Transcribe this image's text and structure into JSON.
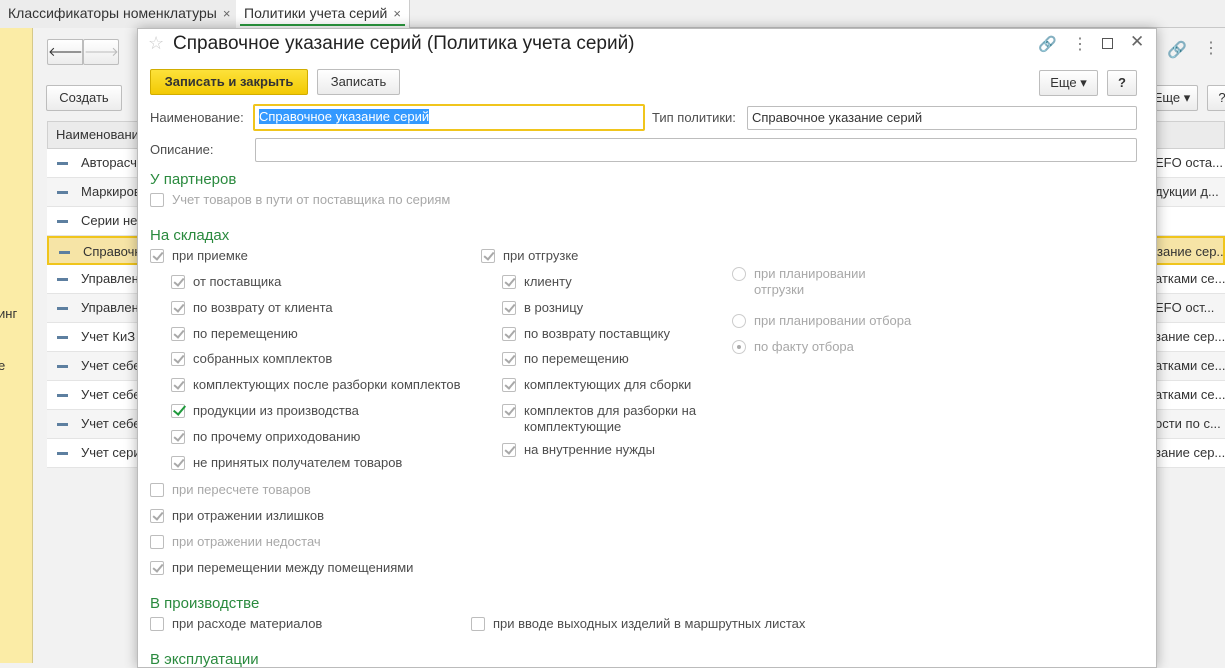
{
  "tabs": [
    {
      "label": "Классификаторы номенклатуры",
      "close": "×"
    },
    {
      "label": "Политики учета серий",
      "close": "×"
    }
  ],
  "sidebar": {
    "frag1": "инг",
    "frag2": "е"
  },
  "background": {
    "create": "Создать",
    "more": "Еще",
    "help": "?",
    "column": "Наименование",
    "rows": [
      {
        "name": "Авторасчет",
        "right": "EFO оста..."
      },
      {
        "name": "Маркировка",
        "right": "дукции д..."
      },
      {
        "name": "Серии не",
        "right": ""
      },
      {
        "name": "Справочное",
        "right": "зание сер..."
      },
      {
        "name": "Управление",
        "right": "атками се..."
      },
      {
        "name": "Управление",
        "right": "EFO ост..."
      },
      {
        "name": "Учет КиЗ",
        "right": "зание сер..."
      },
      {
        "name": "Учет себе",
        "right": "атками се..."
      },
      {
        "name": "Учет себе",
        "right": "атками се..."
      },
      {
        "name": "Учет себе",
        "right": "ости по с..."
      },
      {
        "name": "Учет серий",
        "right": "зание сер..."
      }
    ]
  },
  "modal": {
    "title": "Справочное указание серий (Политика учета серий)",
    "save_close": "Записать и закрыть",
    "save": "Записать",
    "more": "Еще",
    "help": "?",
    "name_label": "Наименование:",
    "name_value": "Справочное указание серий",
    "type_label": "Тип политики:",
    "type_value": "Справочное указание серий",
    "desc_label": "Описание:",
    "desc_value": "",
    "partners": {
      "title": "У партнеров",
      "transit": "Учет товаров в пути от поставщика по сериям"
    },
    "warehouses": {
      "title": "На складах",
      "receipt": "при приемке",
      "receipt_items": [
        "от поставщика",
        "по возврату от клиента",
        "по перемещению",
        "собранных комплектов",
        "комплектующих после разборки комплектов",
        "продукции из производства",
        "по прочему оприходованию",
        "не принятых получателем товаров"
      ],
      "shipment": "при отгрузке",
      "shipment_items": [
        "клиенту",
        "в розницу",
        "по возврату поставщику",
        "по перемещению",
        "комплектующих для сборки",
        "комплектов для разборки на комплектующие",
        "на внутренние нужды"
      ],
      "radios": [
        "при планировании отгрузки",
        "при планировании отбора",
        "по факту отбора"
      ],
      "recount": "при пересчете товаров",
      "surplus": "при отражении излишков",
      "shortage": "при отражении недостач",
      "between_rooms": "при перемещении между помещениями"
    },
    "production": {
      "title": "В производстве",
      "materials": "при расходе материалов",
      "output": "при вводе выходных изделий в маршрутных листах"
    },
    "exploitation": {
      "title": "В эксплуатации"
    }
  }
}
